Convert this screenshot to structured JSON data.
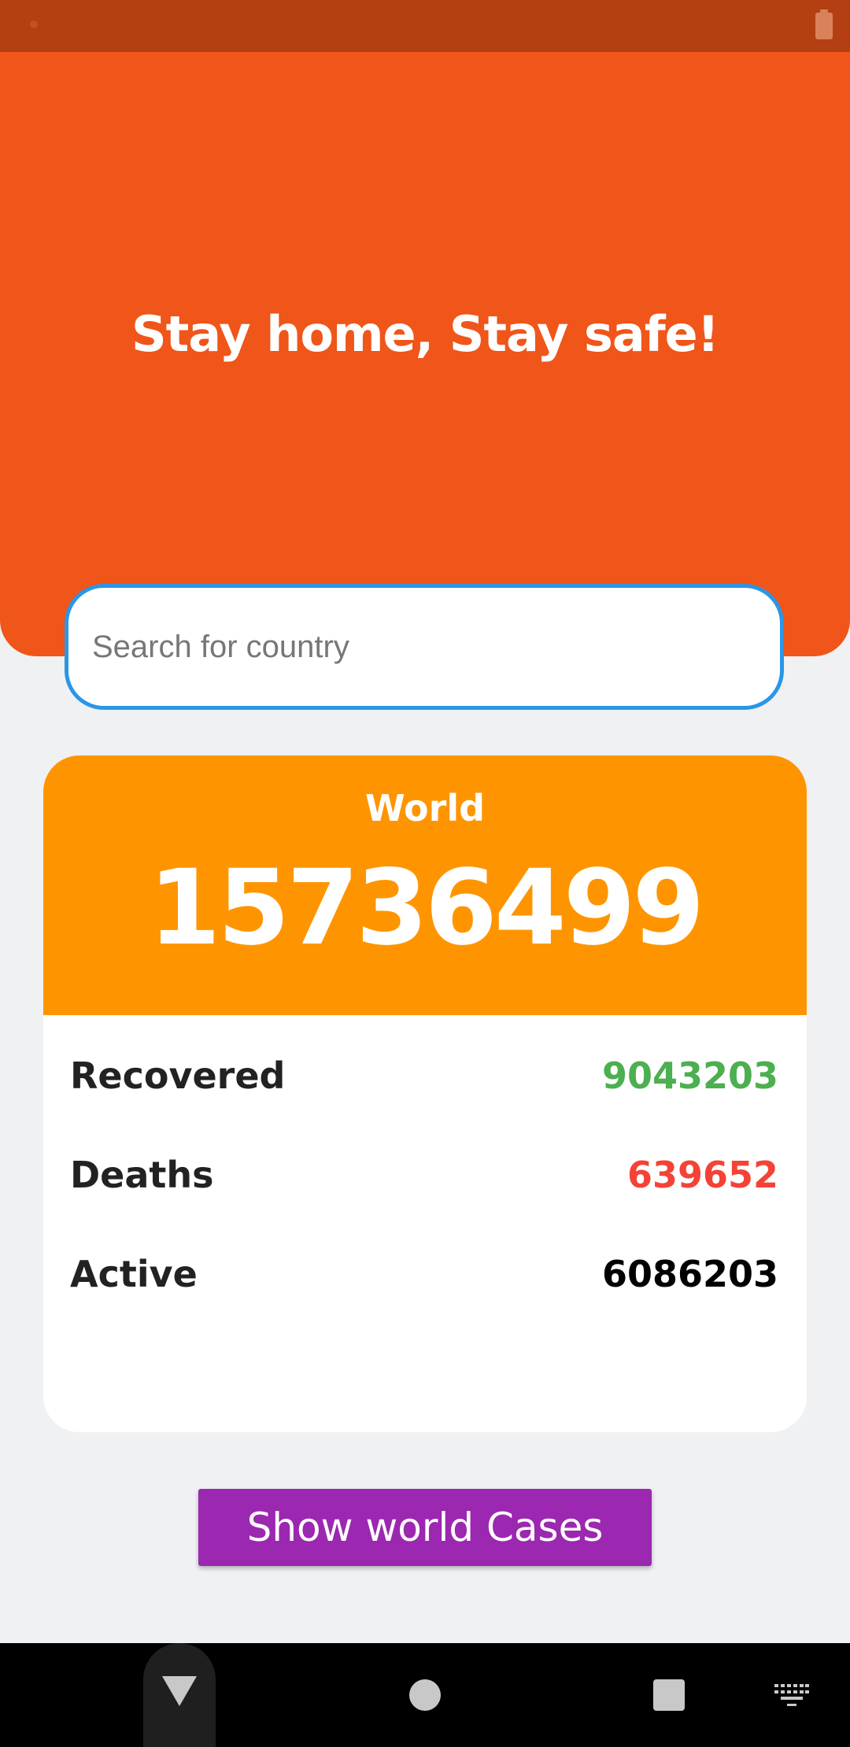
{
  "header": {
    "title": "Stay home, Stay safe!"
  },
  "search": {
    "placeholder": "Search for country"
  },
  "summary": {
    "region": "World",
    "total_cases": "15736499",
    "stats": [
      {
        "label": "Recovered",
        "value": "9043203",
        "color": "#4caf50"
      },
      {
        "label": "Deaths",
        "value": "639652",
        "color": "#f44336"
      },
      {
        "label": "Active",
        "value": "6086203",
        "color": "#000000"
      }
    ]
  },
  "actions": {
    "show_world_label": "Show world Cases"
  },
  "colors": {
    "status_bar": "#b33f12",
    "header": "#f05519",
    "card_accent": "#fe9500",
    "button": "#9c27b0",
    "search_border": "#2a96e6",
    "background": "#f0f1f3"
  },
  "icons": {
    "status": [
      "notification-dot-icon",
      "battery-icon"
    ],
    "navigation": [
      "back-icon",
      "home-icon",
      "recents-icon",
      "keyboard-icon"
    ]
  }
}
